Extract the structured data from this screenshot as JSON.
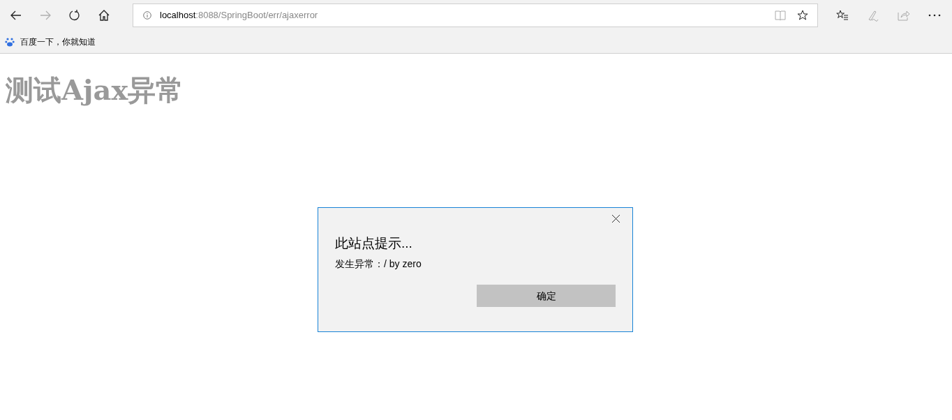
{
  "toolbar": {
    "nav_buttons": [
      {
        "kind": "back",
        "disabled": false
      },
      {
        "kind": "forward",
        "disabled": true
      },
      {
        "kind": "refresh",
        "disabled": false
      },
      {
        "kind": "home",
        "disabled": false
      }
    ],
    "address": {
      "host": "localhost",
      "path": ":8088/SpringBoot/err/ajaxerror"
    }
  },
  "favorites_bar": {
    "items": [
      {
        "label": "百度一下，你就知道"
      }
    ]
  },
  "page": {
    "heading": "测试Ajax异常"
  },
  "dialog": {
    "title": "此站点提示...",
    "message": "发生异常：/ by zero",
    "button": "确定"
  }
}
